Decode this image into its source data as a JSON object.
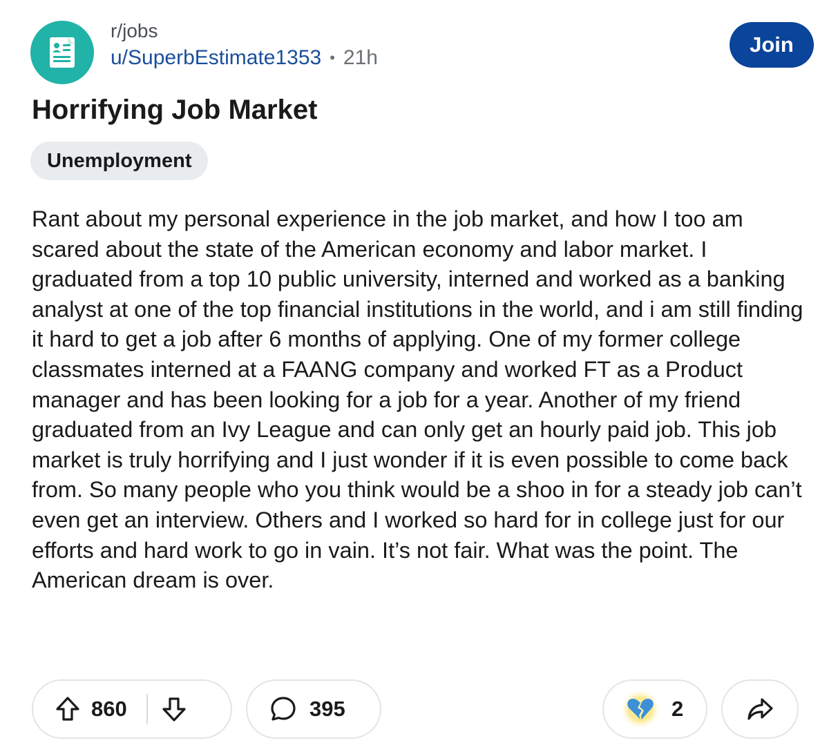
{
  "post": {
    "subreddit": "r/jobs",
    "author": "u/SuperbEstimate1353",
    "separator": "•",
    "time_ago": "21h",
    "title": "Horrifying Job Market",
    "flair": "Unemployment",
    "body": "Rant about my personal experience in the job market, and how I too am scared about the state of the American economy and labor market. I graduated from a top 10 public university, interned and worked as a banking analyst at one of the top financial institutions in the world, and i am still finding it hard to get a job after 6 months of applying. One of my former college classmates interned at a FAANG company and worked FT as a Product manager and has been looking for a job for a year. Another of my friend graduated from an Ivy League and can only get an hourly paid job. This job market is truly horrifying and I just wonder if it is even possible to come back from. So many people who you think would be a shoo in for a steady job can’t even get an interview. Others and I worked so hard for in college just for our efforts and hard work to go in vain. It’s not fair. What was the point. The American dream is over."
  },
  "header": {
    "join_label": "Join"
  },
  "actions": {
    "upvotes": "860",
    "comments": "395",
    "awards": "2"
  },
  "icons": {
    "avatar": "resume-document-icon",
    "upvote": "arrow-up-icon",
    "downvote": "arrow-down-icon",
    "comment": "speech-bubble-icon",
    "award": "broken-heart-icon",
    "share": "share-arrow-icon"
  },
  "colors": {
    "avatar_bg": "#21b3a7",
    "join_bg": "#0a449b",
    "author": "#1a4f9c",
    "flair_bg": "#e9ecef",
    "award_heart": "#3d8fd6"
  }
}
